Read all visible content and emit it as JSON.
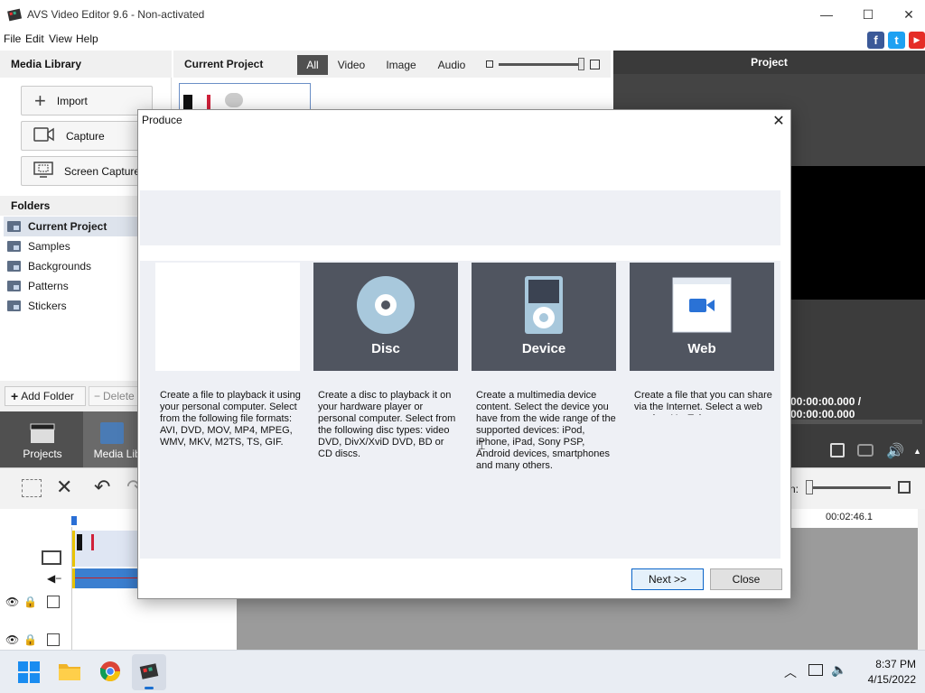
{
  "window": {
    "title": "AVS Video Editor 9.6 - Non-activated",
    "minimize": "—",
    "maximize": "☐",
    "close": "✕"
  },
  "menu": [
    "File",
    "Edit",
    "View",
    "Help"
  ],
  "social": {
    "facebook": "f",
    "twitter": "t",
    "youtube": "▶"
  },
  "media_library": {
    "title": "Media Library",
    "buttons": [
      "Import",
      "Capture",
      "Screen Capture"
    ],
    "folders_title": "Folders",
    "folders": [
      "Current Project",
      "Samples",
      "Backgrounds",
      "Patterns",
      "Stickers"
    ],
    "add_folder": "Add Folder",
    "delete": "Delete"
  },
  "current_project": {
    "title": "Current Project",
    "filters": [
      "All",
      "Video",
      "Image",
      "Audio"
    ],
    "active_filter": "All"
  },
  "preview": {
    "title": "Project",
    "time": "00:00:00.000 / 00:00:00.000"
  },
  "nav": {
    "projects": "Projects",
    "media_library": "Media Libra"
  },
  "timeline": {
    "zoom_label": "n:",
    "timestamp": "00:02:46.1"
  },
  "dialog": {
    "title": "Produce",
    "options": [
      {
        "label": "",
        "description": "Create a file to playback it using your personal computer. Select from the following file formats: AVI, DVD, MOV, MP4, MPEG, WMV, MKV, M2TS, TS, GIF."
      },
      {
        "label": "Disc",
        "description": "Create a disc to playback it on your hardware player or personal computer. Select from the following disc types: video DVD, DivX/XviD DVD, BD or CD discs."
      },
      {
        "label": "Device",
        "description": "Create a multimedia device content. Select the device you have from the wide range of the supported devices: iPod, iPhone, iPad, Sony PSP, Android devices, smartphones and many others."
      },
      {
        "label": "Web",
        "description": "Create a file that you can share via the Internet. Select a web service: YouTube"
      }
    ],
    "next_button": "Next >>",
    "close_button": "Close"
  },
  "taskbar": {
    "time": "8:37 PM",
    "date": "4/15/2022"
  }
}
